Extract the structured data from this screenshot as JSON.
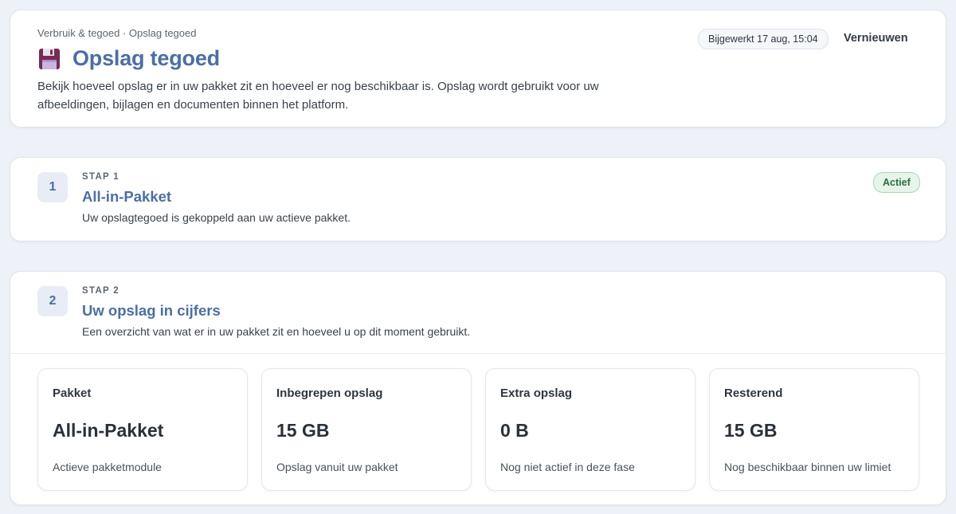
{
  "header": {
    "breadcrumb": "Verbruik & tegoed · Opslag tegoed",
    "icon": "floppy-disk-icon",
    "title": "Opslag tegoed",
    "description": "Bekijk hoeveel opslag er in uw pakket zit en hoeveel er nog beschikbaar is. Opslag wordt gebruikt voor uw afbeeldingen, bijlagen en documenten binnen het platform.",
    "updated": "Bijgewerkt 17 aug, 15:04",
    "refresh_label": "Vernieuwen"
  },
  "step1": {
    "number": "1",
    "kicker": "STAP 1",
    "title": "All-in-Pakket",
    "description": "Uw opslagtegoed is gekoppeld aan uw actieve pakket.",
    "status": "Actief"
  },
  "step2": {
    "number": "2",
    "kicker": "STAP 2",
    "title": "Uw opslag in cijfers",
    "description": "Een overzicht van wat er in uw pakket zit en hoeveel u op dit moment gebruikt.",
    "stats": [
      {
        "label": "Pakket",
        "value": "All-in-Pakket",
        "note": "Actieve pakketmodule"
      },
      {
        "label": "Inbegrepen opslag",
        "value": "15 GB",
        "note": "Opslag vanuit uw pakket"
      },
      {
        "label": "Extra opslag",
        "value": "0 B",
        "note": "Nog niet actief in deze fase"
      },
      {
        "label": "Resterend",
        "value": "15 GB",
        "note": "Nog beschikbaar binnen uw limiet"
      }
    ]
  },
  "colors": {
    "accent": "#4a6fa5",
    "background": "#eef2f8",
    "status_active": "#2b6e3f"
  }
}
